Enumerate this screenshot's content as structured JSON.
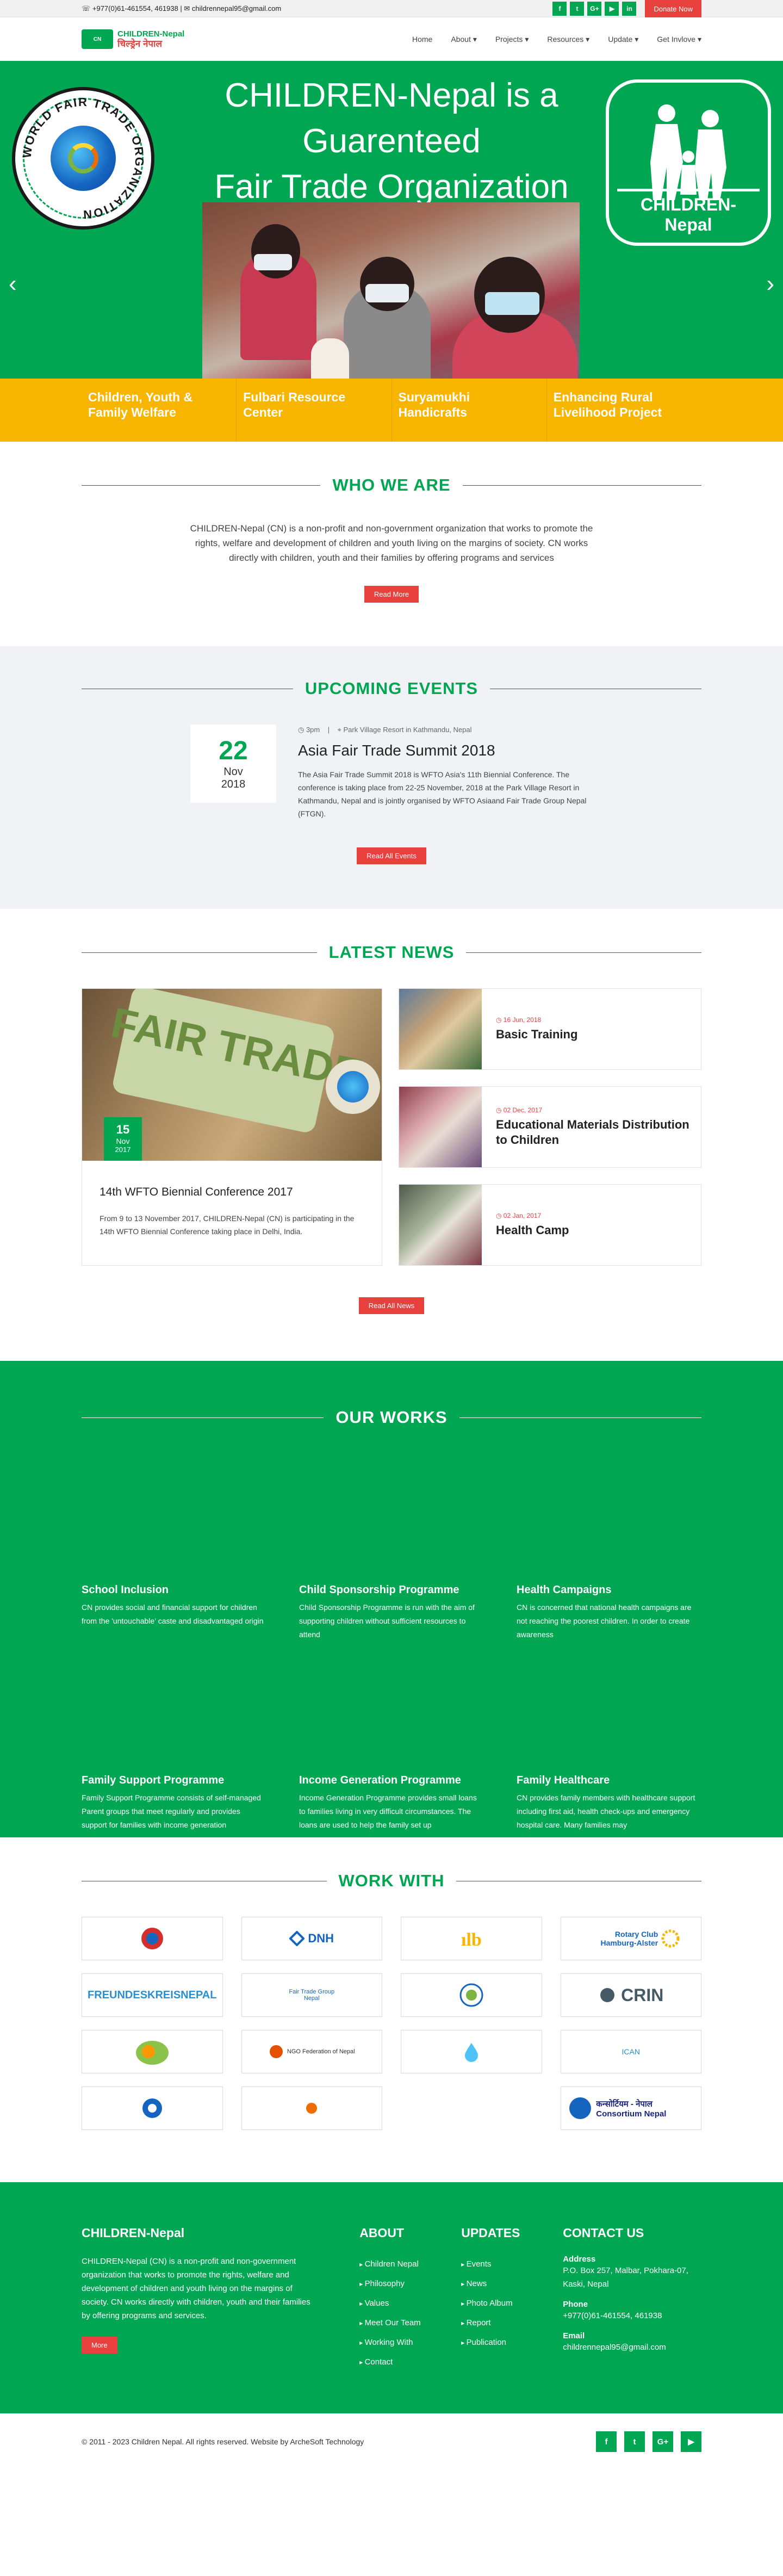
{
  "topbar": {
    "contact": "☏ +977(0)61-461554, 461938 | ✉ childrennepal95@gmail.com",
    "social": [
      "f",
      "t",
      "G+",
      "▶",
      "in"
    ],
    "donate": "Donate Now"
  },
  "nav": {
    "logo_line1": "CHILDREN-Nepal",
    "logo_line2": "चिल्ड्रेन नेपाल",
    "menu": [
      "Home",
      "About ▾",
      "Projects ▾",
      "Resources ▾",
      "Update ▾",
      "Get Invlove ▾"
    ]
  },
  "hero": {
    "title_line1": "CHILDREN-Nepal is a",
    "title_line2": "Guarenteed",
    "title_line3": "Fair Trade Organization",
    "seal_text": "WORLD FAIR TRADE ORGANIZATION",
    "badge_label": "CHILDREN-Nepal",
    "prev": "‹",
    "next": "›",
    "tabs": [
      "Children, Youth & Family Welfare",
      "Fulbari Resource Center",
      "Suryamukhi Handicrafts",
      "Enhancing Rural Livelihood Project"
    ]
  },
  "who": {
    "heading": "WHO WE ARE",
    "text": "CHILDREN-Nepal (CN) is a non-profit and non-government organization that works to promote the rights, welfare and development of children and youth living on the margins of society. CN works directly with children, youth and their families by offering programs and services",
    "button": "Read More"
  },
  "events": {
    "heading": "UPCOMING EVENTS",
    "item": {
      "day": "22",
      "month": "Nov",
      "year": "2018",
      "time": "◷ 3pm",
      "location": "⌖ Park Village Resort in Kathmandu, Nepal",
      "title": "Asia Fair Trade Summit 2018",
      "desc": "The Asia Fair Trade Summit 2018 is WFTO Asia's 11th Biennial Conference. The conference is taking place from 22-25 November, 2018 at the Park Village Resort in Kathmandu, Nepal and is jointly organised by WFTO Asiaand Fair Trade Group  Nepal (FTGN)."
    },
    "button": "Read All Events"
  },
  "news": {
    "heading": "LATEST NEWS",
    "featured": {
      "img_word": "FAIR TRADE",
      "day": "15",
      "month": "Nov",
      "year": "2017",
      "title": "14th WFTO Biennial Conference 2017",
      "desc": "From 9 to 13 November 2017, CHILDREN-Nepal (CN) is participating in the 14th WFTO Biennial Conference taking place in Delhi, India."
    },
    "items": [
      {
        "date": "◷ 16 Jun, 2018",
        "title": "Basic Training"
      },
      {
        "date": "◷ 02 Dec, 2017",
        "title": "Educational Materials Distribution to Children"
      },
      {
        "date": "◷ 02 Jan, 2017",
        "title": "Health Camp"
      }
    ],
    "button": "Read All News"
  },
  "works": {
    "heading": "OUR WORKS",
    "items": [
      {
        "title": "School Inclusion",
        "desc": "CN provides social and financial support for children from the 'untouchable' caste and disadvantaged origin"
      },
      {
        "title": "Child Sponsorship Programme",
        "desc": "Child Sponsorship Programme is run with the aim of supporting children without sufficient resources to attend"
      },
      {
        "title": "Health Campaigns",
        "desc": "CN is concerned that national health campaigns are not reaching the poorest children. In order to create awareness"
      },
      {
        "title": "Family Support Programme",
        "desc": "Family Support Programme consists of self-managed Parent groups that meet regularly and provides support for families with income generation"
      },
      {
        "title": "Income Generation Programme",
        "desc": "Income Generation Programme provides small loans to families living in very difficult circumstances. The loans are used to help the family set up"
      },
      {
        "title": "Family Healthcare",
        "desc": "CN provides family members with healthcare support including first aid, health check-ups and emergency hospital care. Many families may"
      }
    ]
  },
  "partners": {
    "heading": "WORK WITH",
    "items": [
      "",
      "DNH",
      "",
      "Rotary Club Hamburg-Alster",
      "FREUNDESKREISNEPAL",
      "Fair Trade Group Nepal",
      "",
      "CRIN",
      "",
      "NGO Federation of Nepal",
      "",
      "ICAN",
      "",
      "",
      "",
      "कन्सोर्टियम - नेपाल Consortium Nepal"
    ]
  },
  "footer": {
    "about_title": "CHILDREN-Nepal",
    "about_text": "CHILDREN-Nepal (CN) is a non-profit and non-government organization that works to promote the rights, welfare and development of children and youth living on the margins of society. CN works directly with children, youth and their families by offering programs and services.",
    "about_button": "More",
    "col2_title": "ABOUT",
    "col2_links": [
      "Children Nepal",
      "Philosophy",
      "Values",
      "Meet Our Team",
      "Working With",
      "Contact"
    ],
    "col3_title": "UPDATES",
    "col3_links": [
      "Events",
      "News",
      "Photo Album",
      "Report",
      "Publication"
    ],
    "contact_title": "CONTACT US",
    "address_label": "Address",
    "address": "P.O. Box 257, Malbar, Pokhara-07, Kaski, Nepal",
    "phone_label": "Phone",
    "phone": "+977(0)61-461554, 461938",
    "email_label": "Email",
    "email": "childrennepal95@gmail.com"
  },
  "copyright": {
    "text": "© 2011 - 2023 Children Nepal. All rights reserved. Website by ArcheSoft Technology",
    "social": [
      "f",
      "t",
      "G+",
      "▶"
    ]
  },
  "colors": {
    "primary_green": "#00a651",
    "accent_red": "#e8403d",
    "tab_yellow": "#f7b500"
  }
}
